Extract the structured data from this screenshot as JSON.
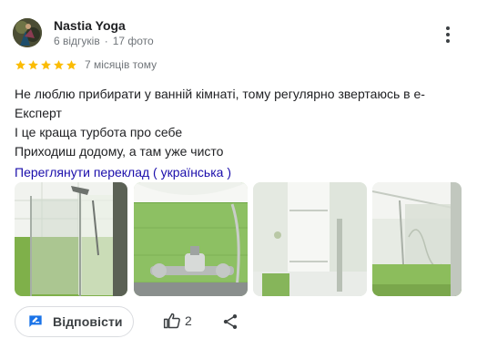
{
  "author": {
    "name": "Nastia Yoga",
    "reviews": "6 відгуків",
    "photos": "17 фото"
  },
  "rating": {
    "stars": 5,
    "max": 5,
    "date": "7 місяців тому",
    "color": "#fbbc04"
  },
  "review": {
    "lines": [
      "Не люблю прибирати у ванній кімнаті, тому регулярно звертаюсь в е-",
      "Експерт",
      "І це краща турбота про себе",
      "Приходиш додому, а там уже чисто"
    ]
  },
  "translate_link": "Переглянути переклад ( українська )",
  "actions": {
    "reply_label": "Відповісти",
    "like_count": "2"
  },
  "icons": {
    "more": "more-vert-icon",
    "reply": "reply-edit-icon",
    "like": "thumb-up-icon",
    "share": "share-icon"
  },
  "colors": {
    "link": "#1a0dab",
    "secondary_text": "#70757a",
    "reply_icon": "#1a73e8"
  }
}
